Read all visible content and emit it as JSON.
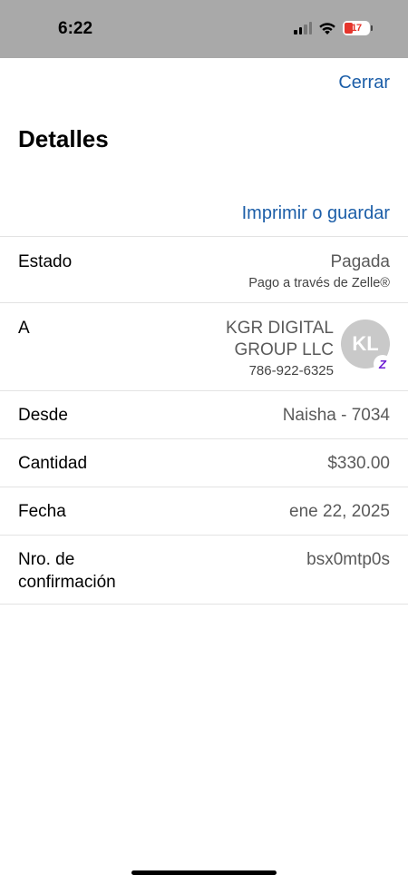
{
  "status_bar": {
    "time": "6:22",
    "battery_level": "17",
    "icons": [
      "cellular-signal-icon",
      "wifi-icon",
      "battery-charging-icon"
    ]
  },
  "header": {
    "close_label": "Cerrar",
    "title": "Detalles",
    "print_label": "Imprimir o guardar"
  },
  "details": {
    "status": {
      "label": "Estado",
      "value": "Pagada",
      "sub": "Pago a través de Zelle®"
    },
    "recipient": {
      "label": "A",
      "name_line1": "KGR DIGITAL",
      "name_line2": "GROUP LLC",
      "phone": "786-922-6325",
      "initials": "KL",
      "badge": "Z"
    },
    "from": {
      "label": "Desde",
      "value": "Naisha - 7034"
    },
    "amount": {
      "label": "Cantidad",
      "value": "$330.00"
    },
    "date": {
      "label": "Fecha",
      "value": "ene 22, 2025"
    },
    "confirmation": {
      "label_line1": "Nro. de",
      "label_line2": "confirmación",
      "value": "bsx0mtp0s"
    }
  },
  "colors": {
    "accent": "#1c5ea8",
    "status_bar_bg": "#a9a9a9",
    "zelle_purple": "#6d1ed4",
    "battery_low": "#e5352c"
  }
}
